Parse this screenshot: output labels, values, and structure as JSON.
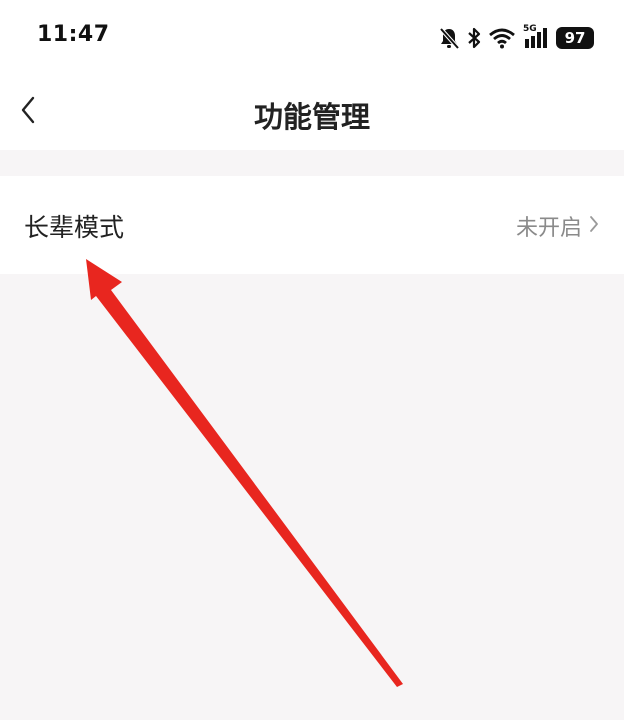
{
  "status_bar": {
    "time": "11:47",
    "signal_label": "5G",
    "battery": "97",
    "icons": [
      "bell-muted-icon",
      "bluetooth-icon",
      "wifi-icon",
      "cellular-5g-icon",
      "battery-icon"
    ]
  },
  "nav": {
    "title": "功能管理",
    "back_icon": "chevron-left-icon"
  },
  "settings": {
    "items": [
      {
        "label": "长辈模式",
        "status": "未开启",
        "chevron_icon": "chevron-right-icon"
      }
    ]
  },
  "annotation": {
    "arrow_color": "#e8261f",
    "arrow_icon": "red-pointer-arrow"
  },
  "colors": {
    "background": "#f7f5f6",
    "surface": "#ffffff",
    "text_primary": "#222222",
    "text_secondary": "#8a8a8a"
  }
}
